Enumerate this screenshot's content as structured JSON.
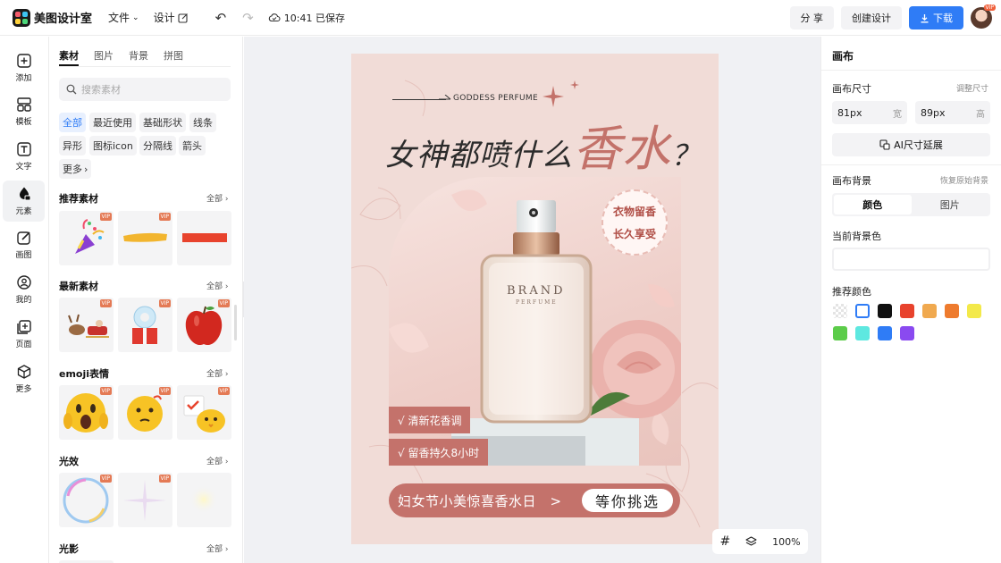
{
  "app": {
    "name": "美图设计室"
  },
  "topbar": {
    "file_label": "文件",
    "design_label": "设计",
    "save_status": "10:41 已保存",
    "share_label": "分 享",
    "create_label": "创建设计",
    "download_label": "下载",
    "avatar_badge": "VIP"
  },
  "rail": [
    {
      "label": "添加",
      "icon": "plus-square-icon"
    },
    {
      "label": "模板",
      "icon": "template-icon"
    },
    {
      "label": "文字",
      "icon": "text-icon"
    },
    {
      "label": "元素",
      "icon": "shapes-icon",
      "active": true
    },
    {
      "label": "画图",
      "icon": "draw-icon"
    },
    {
      "label": "我的",
      "icon": "user-icon"
    },
    {
      "label": "页面",
      "icon": "add-page-icon"
    },
    {
      "label": "更多",
      "icon": "cube-icon"
    }
  ],
  "panel": {
    "tabs": [
      "素材",
      "图片",
      "背景",
      "拼图"
    ],
    "active_tab": "素材",
    "search_placeholder": "搜索素材",
    "chips": [
      "全部",
      "最近使用",
      "基础形状",
      "线条",
      "异形",
      "图标icon",
      "分隔线",
      "箭头",
      "更多"
    ],
    "active_chip": "全部",
    "vip_label": "VIP",
    "sections": [
      {
        "title": "推荐素材",
        "all": "全部",
        "items": [
          "party-popper",
          "yellow-brush-stroke",
          "red-brush-stroke"
        ]
      },
      {
        "title": "最新素材",
        "all": "全部",
        "items": [
          "reindeer-sleigh",
          "snow-globe-gift",
          "red-apple"
        ]
      },
      {
        "title": "emoji表情",
        "all": "全部",
        "items": [
          "screaming-emoji",
          "thinking-emoji",
          "chick-emoji"
        ]
      },
      {
        "title": "光效",
        "all": "全部",
        "items": [
          "bubble-light",
          "star-sparkle",
          "glow-light"
        ]
      },
      {
        "title": "光影",
        "all": "全部",
        "items": []
      }
    ]
  },
  "poster": {
    "brand_line": "GODDESS PERFUME",
    "title_main": "女神都喷什么",
    "title_accent": "香水",
    "title_mark": "？",
    "bottle_brand": "BRAND",
    "bottle_sub": "PERFUME",
    "badge_line1": "衣物留香",
    "badge_line2": "长久享受",
    "tag1": "√ 清新花香调",
    "tag2": "√ 留香持久8小时",
    "cta_text": "妇女节小美惊喜香水日　>",
    "cta_button": "等你挑选"
  },
  "zoom": {
    "level": "100%"
  },
  "right_panel": {
    "title": "画布",
    "size_label": "画布尺寸",
    "adjust_size": "调整尺寸",
    "width_value": "81px",
    "width_unit": "宽",
    "height_value": "89px",
    "height_unit": "高",
    "ai_extend": "AI尺寸延展",
    "bg_label": "画布背景",
    "restore_bg": "恢复原始背景",
    "seg_color": "颜色",
    "seg_image": "图片",
    "current_bg": "当前背景色",
    "recommended": "推荐颜色",
    "colors": [
      "transparent",
      "#ffffff",
      "#111111",
      "#e8432d",
      "#f0a94f",
      "#ee7b2e",
      "#f3e94a",
      "#5ccc4a",
      "#5ee8e0",
      "#2f7cf6",
      "#8a4af0"
    ]
  }
}
